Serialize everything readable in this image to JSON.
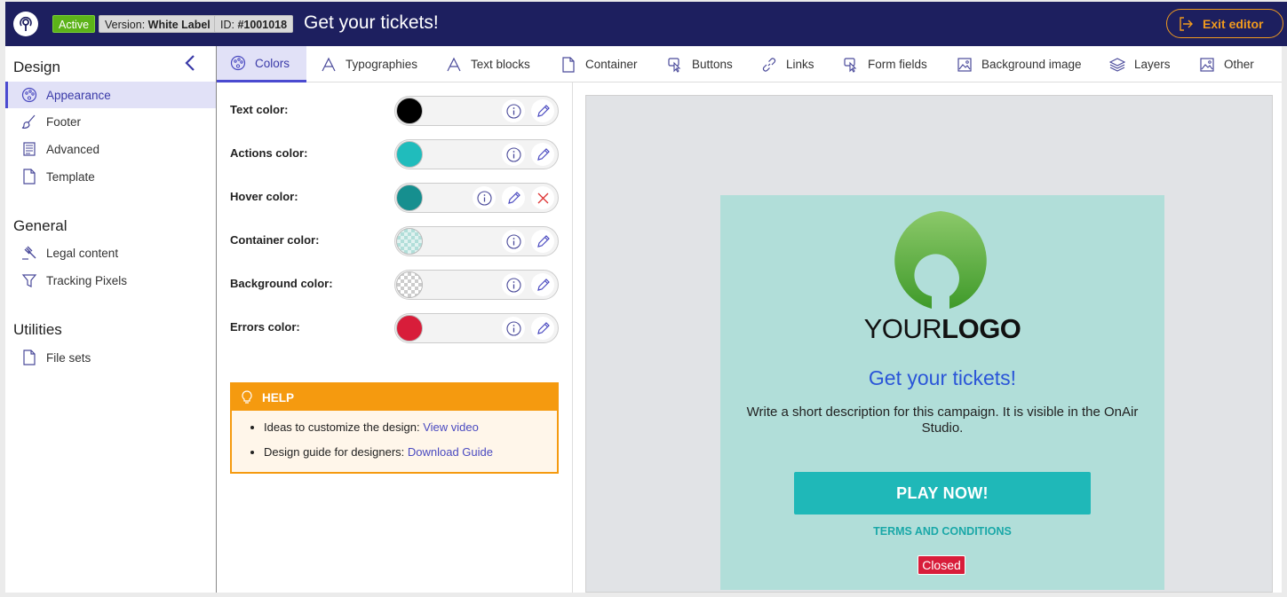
{
  "topbar": {
    "status": "Active",
    "version_label": "Version: ",
    "version_value": "White Label",
    "id_label": "ID: ",
    "id_value": "#1001018",
    "title": "Get your tickets!",
    "exit_label": "Exit editor"
  },
  "sidebar": {
    "design_title": "Design",
    "design_items": [
      "Appearance",
      "Footer",
      "Advanced",
      "Template"
    ],
    "general_title": "General",
    "general_items": [
      "Legal content",
      "Tracking Pixels"
    ],
    "utilities_title": "Utilities",
    "utilities_items": [
      "File sets"
    ]
  },
  "tabs": [
    "Colors",
    "Typographies",
    "Text blocks",
    "Container",
    "Buttons",
    "Links",
    "Form fields",
    "Background image",
    "Layers",
    "Other"
  ],
  "colors": [
    {
      "label": "Text color:",
      "value": "#000000",
      "transparent": false,
      "removable": false
    },
    {
      "label": "Actions color:",
      "value": "#20bcbc",
      "transparent": false,
      "removable": false
    },
    {
      "label": "Hover color:",
      "value": "#168f8f",
      "transparent": false,
      "removable": true
    },
    {
      "label": "Container color:",
      "value": "#b1ded9",
      "transparent": true,
      "removable": false
    },
    {
      "label": "Background color:",
      "value": "",
      "transparent": true,
      "removable": false
    },
    {
      "label": "Errors color:",
      "value": "#d81d3a",
      "transparent": false,
      "removable": false
    }
  ],
  "help": {
    "title": "HELP",
    "item1_text": "Ideas to customize the design: ",
    "item1_link": "View video",
    "item2_text": "Design guide for designers: ",
    "item2_link": "Download Guide"
  },
  "preview": {
    "logo_thin": "YOUR",
    "logo_bold": "LOGO",
    "title": "Get your tickets!",
    "description": "Write a short description for this campaign. It is visible in the OnAir Studio.",
    "play_button": "PLAY NOW!",
    "terms_link": "TERMS AND CONDITIONS",
    "status": "Closed"
  }
}
